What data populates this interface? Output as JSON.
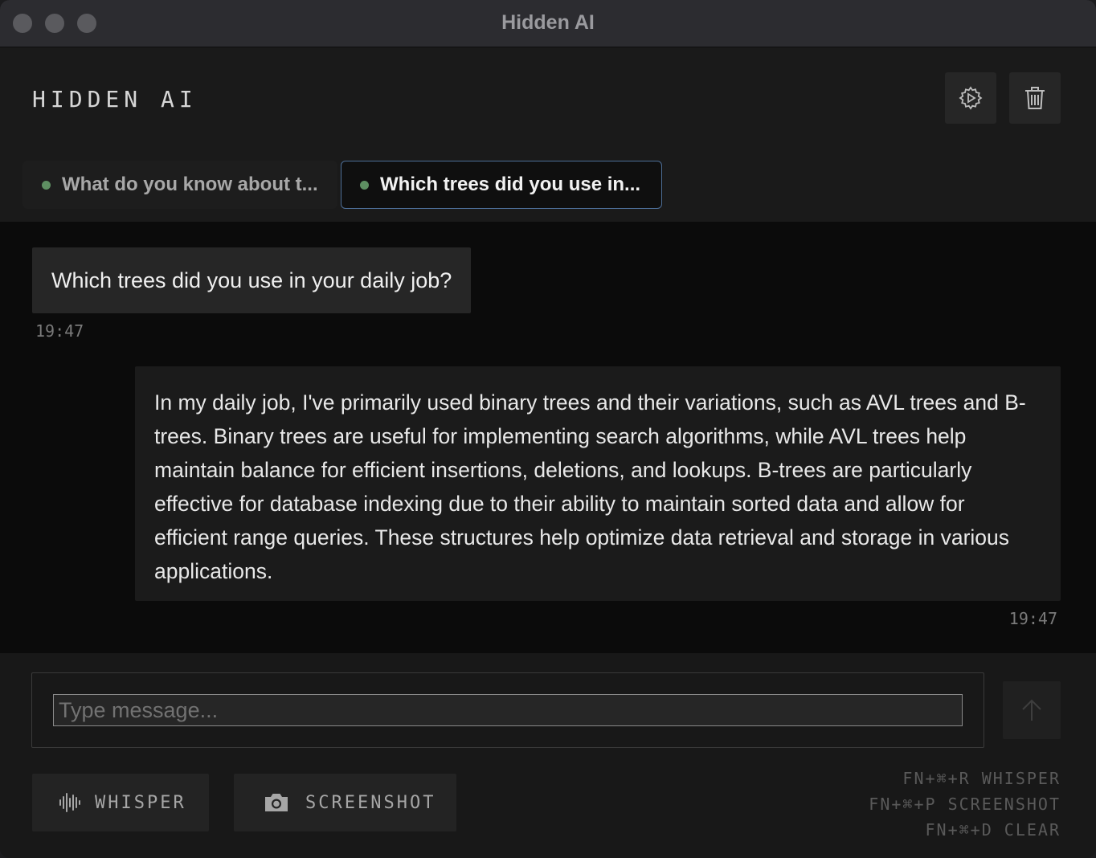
{
  "window": {
    "title": "Hidden AI"
  },
  "header": {
    "brand": "HIDDEN AI",
    "settings_icon": "gear-icon",
    "delete_icon": "trash-icon"
  },
  "tabs": [
    {
      "label": "What do you know about t...",
      "active": false
    },
    {
      "label": "Which trees did you use in...",
      "active": true
    }
  ],
  "messages": [
    {
      "role": "user",
      "text": "Which trees did you use in your daily job?",
      "time": "19:47"
    },
    {
      "role": "assistant",
      "text": "In my daily job, I've primarily used binary trees and their variations, such as AVL trees and B-trees. Binary trees are useful for implementing search algorithms, while AVL trees help maintain balance for efficient insertions, deletions, and lookups. B-trees are particularly effective for database indexing due to their ability to maintain sorted data and allow for efficient range queries. These structures help optimize data retrieval and storage in various applications.",
      "time": "19:47"
    }
  ],
  "composer": {
    "placeholder": "Type message...",
    "value": "",
    "send_icon": "arrow-up-icon"
  },
  "actions": {
    "whisper_label": "WHISPER",
    "whisper_icon": "waveform-icon",
    "screenshot_label": "SCREENSHOT",
    "screenshot_icon": "camera-icon"
  },
  "shortcuts": [
    {
      "keys": "FN+⌘+R",
      "action": "WHISPER"
    },
    {
      "keys": "FN+⌘+P",
      "action": "SCREENSHOT"
    },
    {
      "keys": "FN+⌘+D",
      "action": "CLEAR"
    }
  ],
  "colors": {
    "accent_border": "#4d6e97",
    "status_dot": "#5e8f62"
  }
}
